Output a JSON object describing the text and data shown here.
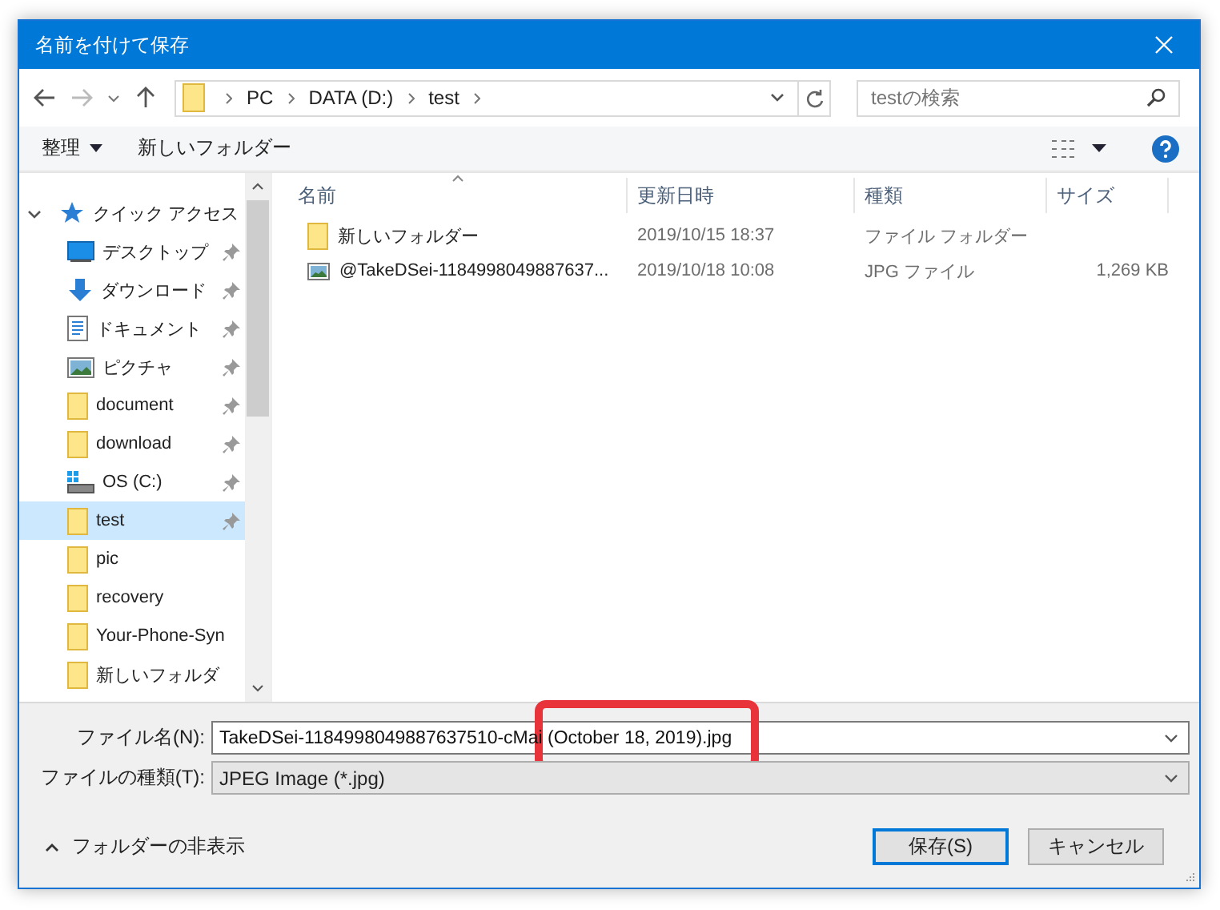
{
  "window": {
    "title": "名前を付けて保存"
  },
  "address": {
    "segments": [
      "PC",
      "DATA (D:)",
      "test"
    ]
  },
  "search": {
    "placeholder": "testの検索"
  },
  "toolbar": {
    "organize": "整理",
    "new_folder": "新しいフォルダー"
  },
  "sidebar": {
    "items": [
      {
        "label": "クイック アクセス",
        "kind": "star",
        "expanded": true,
        "pinned": false,
        "selected": false
      },
      {
        "label": "デスクトップ",
        "kind": "desktop",
        "pinned": true,
        "selected": false
      },
      {
        "label": "ダウンロード",
        "kind": "download",
        "pinned": true,
        "selected": false
      },
      {
        "label": "ドキュメント",
        "kind": "document",
        "pinned": true,
        "selected": false
      },
      {
        "label": "ピクチャ",
        "kind": "picture",
        "pinned": true,
        "selected": false
      },
      {
        "label": "document",
        "kind": "folder",
        "pinned": true,
        "selected": false
      },
      {
        "label": "download",
        "kind": "folder",
        "pinned": true,
        "selected": false
      },
      {
        "label": "OS (C:)",
        "kind": "drive",
        "pinned": true,
        "selected": false
      },
      {
        "label": "test",
        "kind": "folder",
        "pinned": true,
        "selected": true
      },
      {
        "label": "pic",
        "kind": "folder",
        "pinned": false,
        "selected": false
      },
      {
        "label": "recovery",
        "kind": "folder",
        "pinned": false,
        "selected": false
      },
      {
        "label": "Your-Phone-Syn",
        "kind": "folder",
        "pinned": false,
        "selected": false
      },
      {
        "label": "新しいフォルダ",
        "kind": "folder",
        "pinned": false,
        "selected": false
      }
    ]
  },
  "table": {
    "columns": [
      "名前",
      "更新日時",
      "種類",
      "サイズ"
    ],
    "rows": [
      {
        "kind": "folder",
        "name": "新しいフォルダー",
        "modified": "2019/10/15 18:37",
        "type": "ファイル フォルダー",
        "size": ""
      },
      {
        "kind": "image",
        "name": "@TakeDSei-1184998049887637...",
        "modified": "2019/10/18 10:08",
        "type": "JPG ファイル",
        "size": "1,269 KB"
      }
    ]
  },
  "file_name": {
    "label": "ファイル名(N):",
    "value": "TakeDSei-1184998049887637510-cMai (October 18, 2019).jpg"
  },
  "file_type": {
    "label": "ファイルの種類(T):",
    "value": "JPEG Image (*.jpg)"
  },
  "footer": {
    "hide_folders": "フォルダーの非表示",
    "save": "保存(S)",
    "cancel": "キャンセル"
  }
}
